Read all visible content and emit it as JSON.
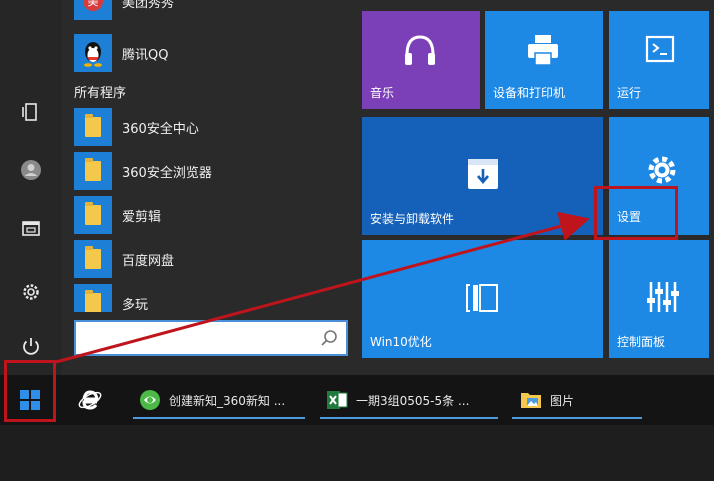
{
  "app_list": {
    "partial_top_item": "美团秀秀",
    "items": [
      {
        "label": "腾讯QQ",
        "icon": "qq-penguin-icon"
      },
      {
        "label": "360安全中心",
        "icon": "folder-icon"
      },
      {
        "label": "360安全浏览器",
        "icon": "folder-icon"
      },
      {
        "label": "爱剪辑",
        "icon": "folder-icon"
      },
      {
        "label": "百度网盘",
        "icon": "folder-icon"
      },
      {
        "label": "多玩",
        "icon": "folder-icon"
      }
    ],
    "all_programs_label": "所有程序"
  },
  "search": {
    "placeholder": "",
    "value": ""
  },
  "left_rail": [
    "tablet-mode-icon",
    "user-avatar-icon",
    "file-explorer-icon",
    "settings-gear-icon",
    "power-icon",
    "windows-start-icon"
  ],
  "tiles": {
    "music": {
      "label": "音乐",
      "color": "#7b3fb8",
      "icon": "headphones-icon"
    },
    "devices_printers": {
      "label": "设备和打印机",
      "color": "#1e88e5",
      "icon": "printer-icon"
    },
    "run": {
      "label": "运行",
      "color": "#1e88e5",
      "icon": "run-command-icon"
    },
    "install_uninstall": {
      "label": "安装与卸载软件",
      "color": "#1560b8",
      "icon": "install-box-icon"
    },
    "settings": {
      "label": "设置",
      "color": "#1e88e5",
      "icon": "gear-icon"
    },
    "win10_optimize": {
      "label": "Win10优化",
      "color": "#1e88e5",
      "icon": "optimize-icon"
    },
    "control_panel": {
      "label": "控制面板",
      "color": "#1e88e5",
      "icon": "sliders-icon"
    }
  },
  "taskbar": {
    "apps": [
      {
        "label": "",
        "icon": "ie-browser-icon"
      },
      {
        "label": "创建新知_360新知 ...",
        "icon": "360-browser-icon"
      },
      {
        "label": "一期3组0505-5条 ...",
        "icon": "excel-icon"
      },
      {
        "label": "图片",
        "icon": "folder-pictures-icon"
      }
    ]
  },
  "colors": {
    "highlight": "#c0141c",
    "accent": "#1e88e5"
  }
}
